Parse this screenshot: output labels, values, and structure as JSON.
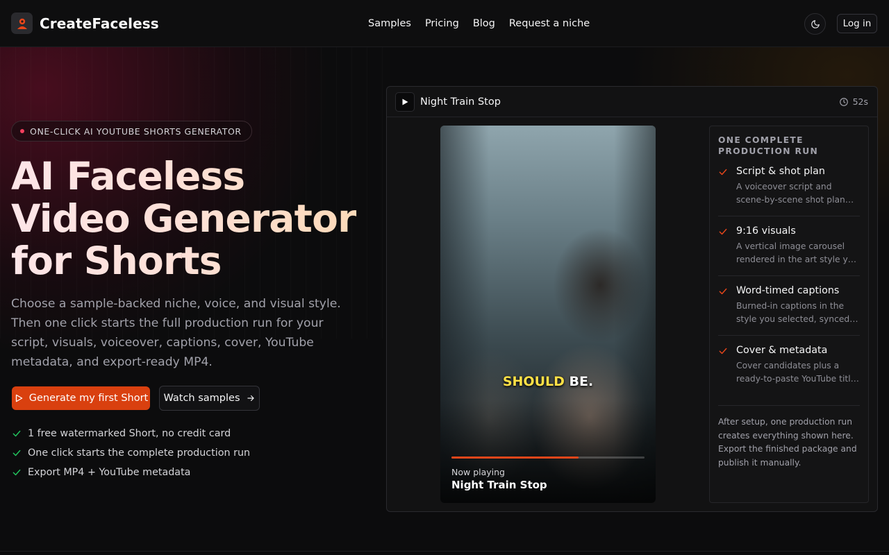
{
  "header": {
    "brand": "CreateFaceless",
    "nav": [
      "Samples",
      "Pricing",
      "Blog",
      "Request a niche"
    ],
    "login_label": "Log in"
  },
  "hero": {
    "badge": "ONE-CLICK AI YOUTUBE SHORTS GENERATOR",
    "title_lines": [
      "AI Faceless",
      "Video Generator",
      "for Shorts"
    ],
    "subtitle": "Choose a sample-backed niche, voice, and visual style. Then one click starts the full production run for your script, visuals, voiceover, captions, cover, YouTube metadata, and export-ready MP4.",
    "primary_cta": "Generate my first Short",
    "secondary_cta": "Watch samples",
    "bullets": [
      "1 free watermarked Short, no credit card",
      "One click starts the complete production run",
      "Export MP4 + YouTube metadata"
    ]
  },
  "player": {
    "title": "Night Train Stop",
    "duration": "52s",
    "caption_highlight": "SHOULD",
    "caption_rest": " BE.",
    "progress": 0.66,
    "now_playing_label": "Now playing",
    "now_playing_title": "Night Train Stop"
  },
  "production": {
    "heading": "ONE COMPLETE PRODUCTION RUN",
    "steps": [
      {
        "title": "Script & shot plan",
        "desc": "A voiceover script and scene-by-scene shot plan generated for your niche."
      },
      {
        "title": "9:16 visuals",
        "desc": "A vertical image carousel rendered in the art style you picked."
      },
      {
        "title": "Word-timed captions",
        "desc": "Burned-in captions in the style you selected, synced word by word."
      },
      {
        "title": "Cover & metadata",
        "desc": "Cover candidates plus a ready-to-paste YouTube title, description and tags."
      }
    ],
    "footer": "After setup, one production run creates everything shown here. Export the finished package and publish it manually."
  },
  "colors": {
    "accent": "#d9400f",
    "check_green": "#22c55e",
    "check_orange": "#e8461a",
    "caption_highlight": "#fde047"
  }
}
